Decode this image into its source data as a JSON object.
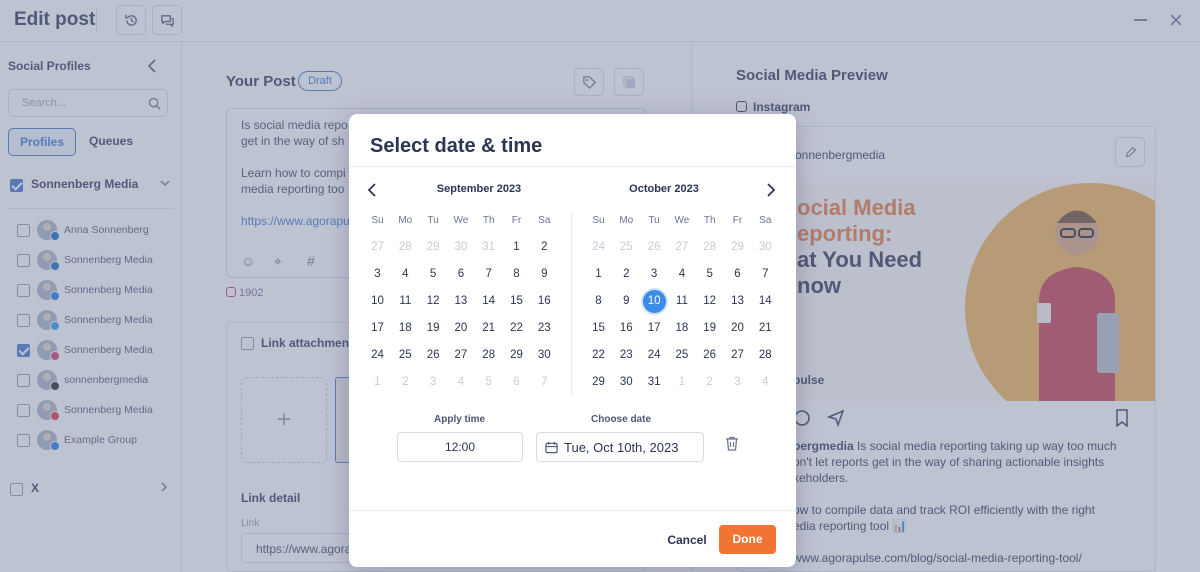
{
  "header": {
    "title": "Edit post"
  },
  "sidebar": {
    "title": "Social Profiles",
    "search_placeholder": "Search...",
    "tabs": {
      "profiles": "Profiles",
      "queues": "Queues"
    },
    "group": {
      "label": "Sonnenberg Media",
      "checked": true
    },
    "profiles": [
      {
        "name": "Anna Sonnenberg",
        "network": "linkedin",
        "badge_color": "#0a66c2",
        "checked": false
      },
      {
        "name": "Sonnenberg Media",
        "network": "linkedin",
        "badge_color": "#0a66c2",
        "checked": false
      },
      {
        "name": "Sonnenberg Media",
        "network": "facebook",
        "badge_color": "#1877f2",
        "checked": false
      },
      {
        "name": "Sonnenberg Media",
        "network": "twitter",
        "badge_color": "#1da1f2",
        "checked": false
      },
      {
        "name": "Sonnenberg Media",
        "network": "instagram",
        "badge_color": "#d6336c",
        "checked": true
      },
      {
        "name": "sonnenbergmedia",
        "network": "threads",
        "badge_color": "#222222",
        "checked": false
      },
      {
        "name": "Sonnenberg Media",
        "network": "youtube",
        "badge_color": "#e02f2f",
        "checked": false
      },
      {
        "name": "Example Group",
        "network": "facebook",
        "badge_color": "#1877f2",
        "checked": false
      }
    ],
    "x_group": {
      "label": "X"
    }
  },
  "editor": {
    "title": "Your Post",
    "status": "Draft",
    "text_lines": [
      "Is social media repo",
      "get in the way of sh",
      "",
      "Learn how to compi",
      "media reporting too",
      "",
      "https://www.agorapu"
    ],
    "char_count": "1902",
    "link_attachment_label": "Link attachment",
    "link_detail_label": "Link detail",
    "link_field_label": "Link",
    "link_value": "https://www.agorapu"
  },
  "preview": {
    "title": "Social Media Preview",
    "network_label": "Instagram",
    "handle": "sonnenbergmedia",
    "image_headline": [
      "ocial Media",
      "eporting:",
      "at You Need",
      "now"
    ],
    "brand": "pulse",
    "caption_lines": [
      {
        "bold": "bergmedia",
        "text": " Is social media reporting taking up way too much"
      },
      {
        "bold": "",
        "text": "on't let reports get in the way of sharing actionable insights"
      },
      {
        "bold": "",
        "text": "keholders."
      },
      {
        "bold": "",
        "text": ""
      },
      {
        "bold": "",
        "text": "ow to compile data and track ROI efficiently with the right"
      },
      {
        "bold": "",
        "text": "edia reporting tool 📊"
      },
      {
        "bold": "",
        "text": ""
      },
      {
        "bold": "",
        "text": "www.agorapulse.com/blog/social-media-reporting-tool/"
      }
    ]
  },
  "modal": {
    "title": "Select date & time",
    "weekdays": [
      "Su",
      "Mo",
      "Tu",
      "We",
      "Th",
      "Fr",
      "Sa"
    ],
    "months": [
      {
        "name": "September 2023",
        "weeks": [
          [
            [
              "27",
              1
            ],
            [
              "28",
              1
            ],
            [
              "29",
              1
            ],
            [
              "30",
              1
            ],
            [
              "31",
              1
            ],
            [
              "1",
              0
            ],
            [
              "2",
              0
            ]
          ],
          [
            [
              "3",
              0
            ],
            [
              "4",
              0
            ],
            [
              "5",
              0
            ],
            [
              "6",
              0
            ],
            [
              "7",
              0
            ],
            [
              "8",
              0
            ],
            [
              "9",
              0
            ]
          ],
          [
            [
              "10",
              0
            ],
            [
              "11",
              0
            ],
            [
              "12",
              0
            ],
            [
              "13",
              0
            ],
            [
              "14",
              0
            ],
            [
              "15",
              0
            ],
            [
              "16",
              0
            ]
          ],
          [
            [
              "17",
              0
            ],
            [
              "18",
              0
            ],
            [
              "19",
              0
            ],
            [
              "20",
              0
            ],
            [
              "21",
              0
            ],
            [
              "22",
              0
            ],
            [
              "23",
              0
            ]
          ],
          [
            [
              "24",
              0
            ],
            [
              "25",
              0
            ],
            [
              "26",
              0
            ],
            [
              "27",
              0
            ],
            [
              "28",
              0
            ],
            [
              "29",
              0
            ],
            [
              "30",
              0
            ]
          ],
          [
            [
              "1",
              1
            ],
            [
              "2",
              1
            ],
            [
              "3",
              1
            ],
            [
              "4",
              1
            ],
            [
              "5",
              1
            ],
            [
              "6",
              1
            ],
            [
              "7",
              1
            ]
          ]
        ]
      },
      {
        "name": "October 2023",
        "weeks": [
          [
            [
              "24",
              1
            ],
            [
              "25",
              1
            ],
            [
              "26",
              1
            ],
            [
              "27",
              1
            ],
            [
              "28",
              1
            ],
            [
              "29",
              1
            ],
            [
              "30",
              1
            ]
          ],
          [
            [
              "1",
              0
            ],
            [
              "2",
              0
            ],
            [
              "3",
              0
            ],
            [
              "4",
              0
            ],
            [
              "5",
              0
            ],
            [
              "6",
              0
            ],
            [
              "7",
              0
            ]
          ],
          [
            [
              "8",
              0
            ],
            [
              "9",
              0
            ],
            [
              "10",
              2
            ],
            [
              "11",
              0
            ],
            [
              "12",
              0
            ],
            [
              "13",
              0
            ],
            [
              "14",
              0
            ]
          ],
          [
            [
              "15",
              0
            ],
            [
              "16",
              0
            ],
            [
              "17",
              0
            ],
            [
              "18",
              0
            ],
            [
              "19",
              0
            ],
            [
              "20",
              0
            ],
            [
              "21",
              0
            ]
          ],
          [
            [
              "22",
              0
            ],
            [
              "23",
              0
            ],
            [
              "24",
              0
            ],
            [
              "25",
              0
            ],
            [
              "26",
              0
            ],
            [
              "27",
              0
            ],
            [
              "28",
              0
            ]
          ],
          [
            [
              "29",
              0
            ],
            [
              "30",
              0
            ],
            [
              "31",
              0
            ],
            [
              "1",
              1
            ],
            [
              "2",
              1
            ],
            [
              "3",
              1
            ],
            [
              "4",
              1
            ]
          ]
        ]
      }
    ],
    "selected_date": "10",
    "apply_time_label": "Apply time",
    "time_value": "12:00",
    "choose_date_label": "Choose date",
    "date_value": "Tue, Oct 10th, 2023",
    "cancel_label": "Cancel",
    "done_label": "Done",
    "colors": {
      "accent": "#3b8be8",
      "done": "#f07433"
    }
  }
}
